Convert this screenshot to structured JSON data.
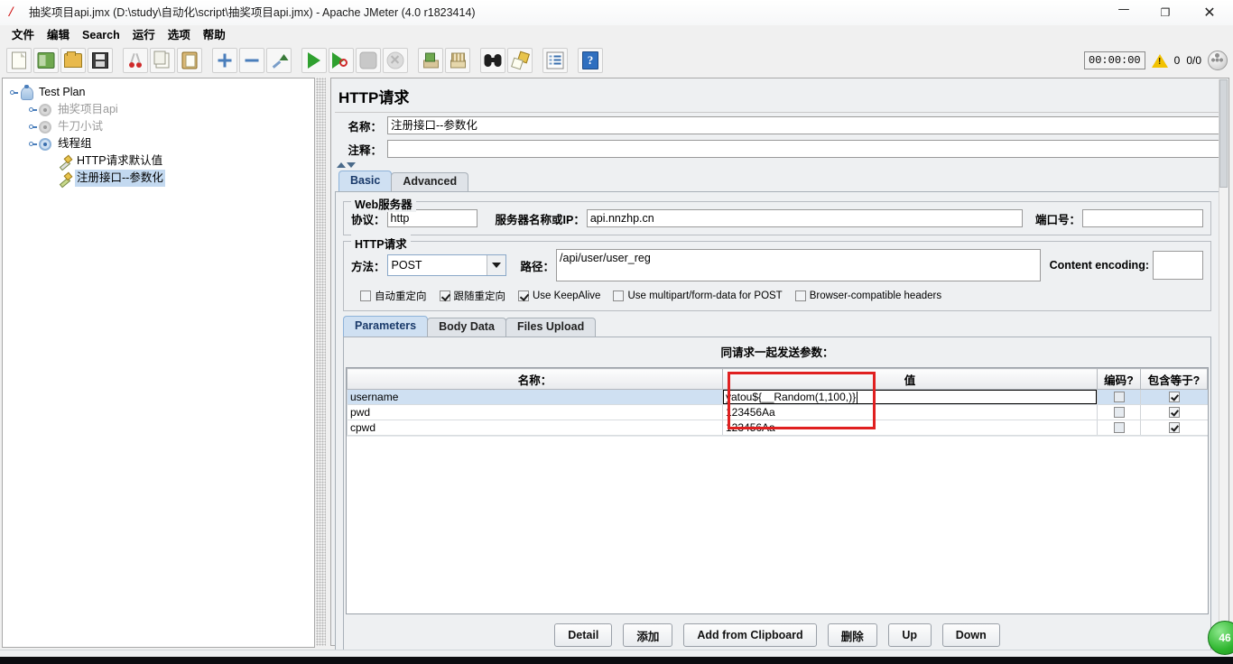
{
  "window": {
    "title": "抽奖项目api.jmx (D:\\study\\自动化\\script\\抽奖项目api.jmx) - Apache JMeter (4.0 r1823414)",
    "app_icon": "jmeter-feather-icon",
    "minimize": "—",
    "maximize": "❐",
    "close": "✕"
  },
  "menubar": {
    "items": [
      {
        "label": "文件",
        "name": "menu-file"
      },
      {
        "label": "编辑",
        "name": "menu-edit"
      },
      {
        "label": "Search",
        "name": "menu-search"
      },
      {
        "label": "运行",
        "name": "menu-run"
      },
      {
        "label": "选项",
        "name": "menu-options"
      },
      {
        "label": "帮助",
        "name": "menu-help"
      }
    ]
  },
  "toolbar": {
    "buttons": [
      {
        "name": "new-icon",
        "cls": "i-page"
      },
      {
        "name": "templates-icon",
        "cls": "i-tpl"
      },
      {
        "name": "open-icon",
        "cls": "i-open"
      },
      {
        "name": "save-icon",
        "cls": "i-save"
      },
      {
        "name": "cut-icon",
        "cls": "i-cut"
      },
      {
        "name": "copy-icon",
        "cls": "i-copy"
      },
      {
        "name": "paste-icon",
        "cls": "i-paste"
      },
      {
        "name": "expand-all-icon",
        "cls": "i-plus"
      },
      {
        "name": "collapse-all-icon",
        "cls": "i-minus"
      },
      {
        "name": "toggle-icon",
        "cls": "i-undoarr"
      },
      {
        "name": "start-icon",
        "cls": "i-play"
      },
      {
        "name": "start-no-pauses-icon",
        "cls": "i-playno"
      },
      {
        "name": "stop-icon",
        "cls": "i-stop"
      },
      {
        "name": "shutdown-icon",
        "cls": "i-stopx"
      },
      {
        "name": "clear-icon",
        "cls": "i-brush"
      },
      {
        "name": "clear-all-icon",
        "cls": "i-brush2"
      },
      {
        "name": "search-icon",
        "cls": "i-bino"
      },
      {
        "name": "reset-search-icon",
        "cls": "i-clean"
      },
      {
        "name": "function-helper-icon",
        "cls": "i-list"
      },
      {
        "name": "help-icon",
        "cls": "i-help"
      }
    ],
    "status": {
      "elapsed": "00:00:00",
      "warning_icon": "warning-triangle-icon",
      "error_count": "0",
      "threads": "0/0",
      "activity_icon": "activity-indicator-icon"
    }
  },
  "tree": {
    "nodes": [
      {
        "label": "Test Plan",
        "icon": "test-plan-icon",
        "depth": 0,
        "state": "enabled",
        "name": "tree-node-test-plan"
      },
      {
        "label": "抽奖项目api",
        "icon": "thread-group-icon",
        "depth": 1,
        "state": "disabled",
        "name": "tree-node-choujiang-api"
      },
      {
        "label": "牛刀小试",
        "icon": "thread-group-icon",
        "depth": 1,
        "state": "disabled",
        "name": "tree-node-niudaoxiaoshi"
      },
      {
        "label": "线程组",
        "icon": "thread-group-icon",
        "depth": 1,
        "state": "enabled",
        "name": "tree-node-thread-group"
      },
      {
        "label": "HTTP请求默认值",
        "icon": "http-defaults-icon",
        "depth": 2,
        "state": "enabled",
        "name": "tree-node-http-defaults"
      },
      {
        "label": "注册接口--参数化",
        "icon": "http-sampler-icon",
        "depth": 2,
        "state": "selected",
        "name": "tree-node-http-sampler"
      }
    ]
  },
  "panel": {
    "title": "HTTP请求",
    "name_label": "名称：",
    "name_value": "注册接口--参数化",
    "comment_label": "注释：",
    "comment_value": "",
    "top_tabs": [
      {
        "label": "Basic",
        "active": true,
        "name": "tab-basic"
      },
      {
        "label": "Advanced",
        "active": false,
        "name": "tab-advanced"
      }
    ],
    "web_server": {
      "group_title": "Web服务器",
      "protocol_label": "协议：",
      "protocol_value": "http",
      "server_label": "服务器名称或IP：",
      "server_value": "api.nnzhp.cn",
      "port_label": "端口号：",
      "port_value": ""
    },
    "http_request": {
      "group_title": "HTTP请求",
      "method_label": "方法：",
      "method_value": "POST",
      "path_label": "路径：",
      "path_value": "/api/user/user_reg",
      "content_encoding_label": "Content encoding:",
      "content_encoding_value": "",
      "checkboxes": [
        {
          "label": "自动重定向",
          "checked": false,
          "name": "checkbox-auto-redirect"
        },
        {
          "label": "跟随重定向",
          "checked": true,
          "name": "checkbox-follow-redirect"
        },
        {
          "label": "Use KeepAlive",
          "checked": true,
          "name": "checkbox-use-keepalive"
        },
        {
          "label": "Use multipart/form-data for POST",
          "checked": false,
          "name": "checkbox-multipart"
        },
        {
          "label": "Browser-compatible headers",
          "checked": false,
          "name": "checkbox-browser-compatible"
        }
      ]
    },
    "param_tabs": [
      {
        "label": "Parameters",
        "active": true,
        "name": "tab-parameters"
      },
      {
        "label": "Body Data",
        "active": false,
        "name": "tab-body-data"
      },
      {
        "label": "Files Upload",
        "active": false,
        "name": "tab-files-upload"
      }
    ],
    "table": {
      "caption": "同请求一起发送参数：",
      "headers": [
        "名称：",
        "值",
        "编码?",
        "包含等于?"
      ],
      "rows": [
        {
          "name": "username",
          "value": "yatou${__Random(1,100,)}",
          "encode": false,
          "include_equals": true,
          "selected": true,
          "editing": true
        },
        {
          "name": "pwd",
          "value": "123456Aa",
          "encode": false,
          "include_equals": true,
          "selected": false,
          "editing": false
        },
        {
          "name": "cpwd",
          "value": "123456Aa",
          "encode": false,
          "include_equals": true,
          "selected": false,
          "editing": false
        }
      ]
    },
    "buttons": [
      {
        "label": "Detail",
        "name": "detail-button"
      },
      {
        "label": "添加",
        "name": "add-button"
      },
      {
        "label": "Add from Clipboard",
        "name": "add-from-clipboard-button"
      },
      {
        "label": "删除",
        "name": "delete-button"
      },
      {
        "label": "Up",
        "name": "up-button"
      },
      {
        "label": "Down",
        "name": "down-button"
      }
    ]
  },
  "overlay": {
    "highlight_color": "#e02020",
    "corner_badge": "46"
  }
}
